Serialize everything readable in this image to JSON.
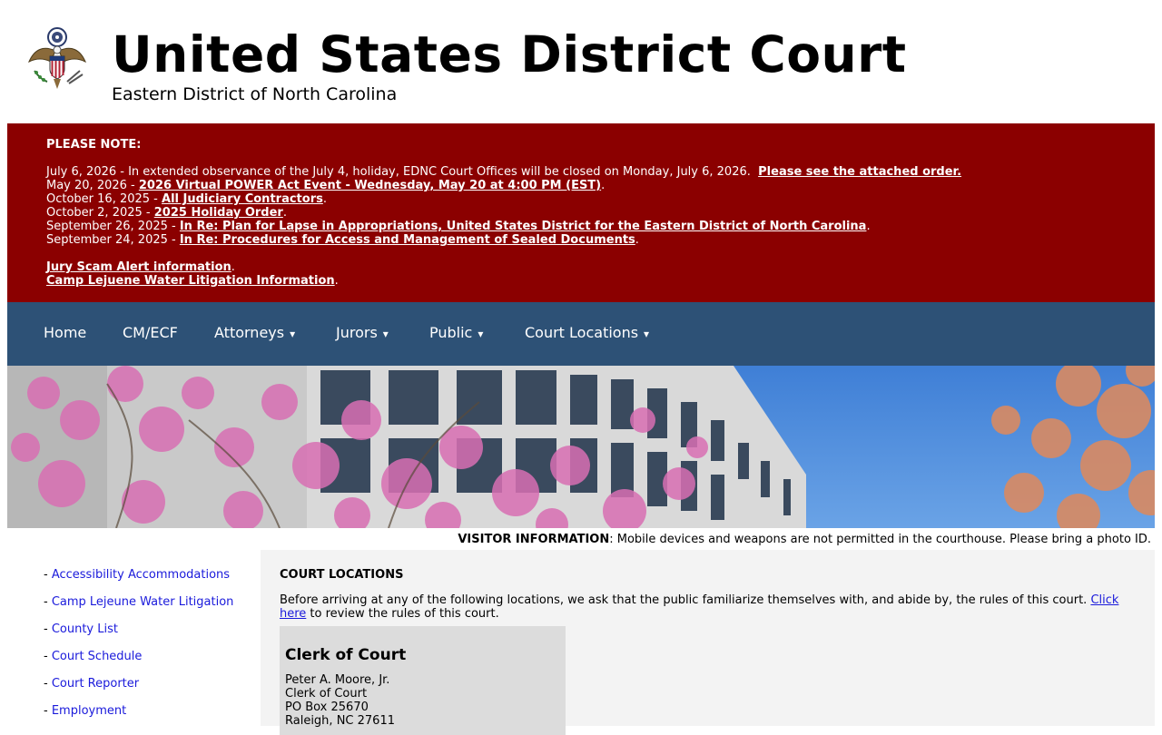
{
  "header": {
    "title": "United States District Court",
    "subtitle": "Eastern District of North Carolina",
    "seal_icon": "great-seal-icon"
  },
  "notice": {
    "heading": "PLEASE NOTE:",
    "items": [
      {
        "prefix": "July 6, 2026 - In extended observance of the July 4, holiday, EDNC Court Offices will be closed on Monday, July 6, 2026.  ",
        "link": "Please see the attached order.",
        "suffix": ""
      },
      {
        "prefix": "May 20, 2026 - ",
        "link": "2026 Virtual POWER Act Event - Wednesday, May 20 at 4:00 PM (EST)",
        "suffix": "."
      },
      {
        "prefix": "October 16, 2025 - ",
        "link": "All Judiciary Contractors",
        "suffix": "."
      },
      {
        "prefix": "October 2, 2025 - ",
        "link": "2025 Holiday Order",
        "suffix": "."
      },
      {
        "prefix": "September 26, 2025 - ",
        "link": "In Re: Plan for Lapse in Appropriations, United States District for the Eastern District of North Carolina",
        "suffix": "."
      },
      {
        "prefix": "September 24, 2025 - ",
        "link": "In Re: Procedures for Access and Management of Sealed Documents",
        "suffix": "."
      }
    ],
    "extra": [
      {
        "link": "Jury Scam Alert information",
        "suffix": "."
      },
      {
        "link": "Camp Lejuene Water Litigation Information",
        "suffix": "."
      }
    ],
    "bg_color": "#8b0000"
  },
  "nav": {
    "bg_color": "#2d5176",
    "items": [
      {
        "label": "Home",
        "dropdown": false
      },
      {
        "label": "CM/ECF",
        "dropdown": false
      },
      {
        "label": "Attorneys",
        "dropdown": true
      },
      {
        "label": "Jurors",
        "dropdown": true
      },
      {
        "label": "Public",
        "dropdown": true
      },
      {
        "label": "Court Locations",
        "dropdown": true
      }
    ],
    "caret": "▾"
  },
  "visitor": {
    "label": "VISITOR INFORMATION",
    "text": ": Mobile devices and weapons are not permitted in the courthouse. Please bring a photo ID."
  },
  "sidebar": {
    "dash": "- ",
    "items": [
      {
        "label": "Accessibility Accommodations"
      },
      {
        "label": "Camp Lejeune Water Litigation"
      },
      {
        "label": "County List"
      },
      {
        "label": "Court Schedule"
      },
      {
        "label": "Court Reporter"
      },
      {
        "label": "Employment"
      }
    ]
  },
  "content": {
    "title": "COURT LOCATIONS",
    "intro_text": "Before arriving at any of the following locations, we ask that the public familiarize themselves with, and abide by, the rules of this court. ",
    "intro_link": "Click here",
    "intro_suffix": " to review the rules of this court.",
    "card": {
      "title": "Clerk of Court",
      "lines": [
        "Peter A. Moore, Jr.",
        "Clerk of Court",
        "PO Box 25670",
        "Raleigh, NC 27611"
      ]
    }
  }
}
